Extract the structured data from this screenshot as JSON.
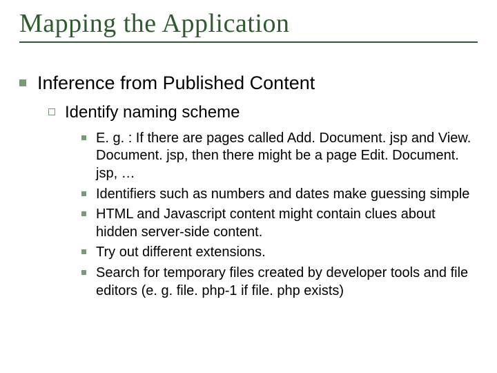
{
  "title": "Mapping the Application",
  "level1": "Inference from Published Content",
  "level2": "Identify naming scheme",
  "level3": [
    "E. g. : If there are pages called Add. Document. jsp and View. Document. jsp, then there might be a page Edit. Document. jsp, …",
    "Identifiers such as numbers and dates make guessing simple",
    "HTML and Javascript content might contain clues about hidden server-side content.",
    "Try out different extensions.",
    "Search for temporary files created by developer tools and file editors (e. g. file. php-1 if file. php exists)"
  ]
}
